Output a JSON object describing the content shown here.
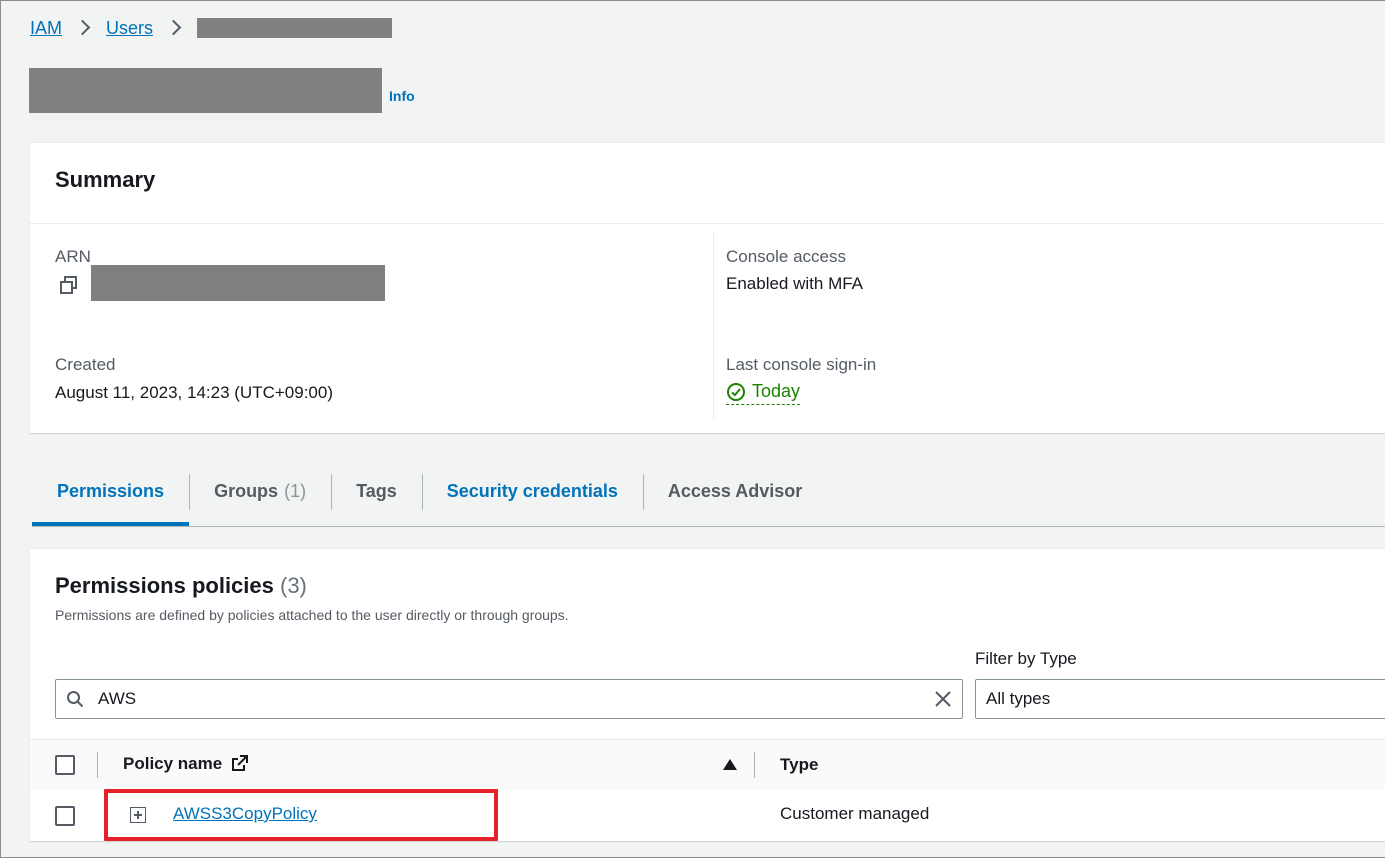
{
  "breadcrumb": {
    "root": "IAM",
    "users": "Users"
  },
  "header": {
    "info": "Info"
  },
  "summary": {
    "title": "Summary",
    "arn_label": "ARN",
    "created_label": "Created",
    "created_value": "August 11, 2023, 14:23 (UTC+09:00)",
    "console_access_label": "Console access",
    "console_access_value": "Enabled with MFA",
    "last_signin_label": "Last console sign-in",
    "last_signin_value": "Today"
  },
  "tabs": [
    {
      "label": "Permissions",
      "count": ""
    },
    {
      "label": "Groups",
      "count": "(1)"
    },
    {
      "label": "Tags",
      "count": ""
    },
    {
      "label": "Security credentials",
      "count": ""
    },
    {
      "label": "Access Advisor",
      "count": ""
    }
  ],
  "policies": {
    "title": "Permissions policies",
    "count": "(3)",
    "description": "Permissions are defined by policies attached to the user directly or through groups.",
    "search_value": "AWS",
    "filter_label": "Filter by Type",
    "filter_value": "All types",
    "columns": {
      "name": "Policy name",
      "type": "Type"
    },
    "rows": [
      {
        "name": "AWSS3CopyPolicy",
        "type": "Customer managed"
      }
    ]
  },
  "colors": {
    "link": "#0073bb",
    "success": "#1d8102",
    "highlight": "#e8202a"
  }
}
